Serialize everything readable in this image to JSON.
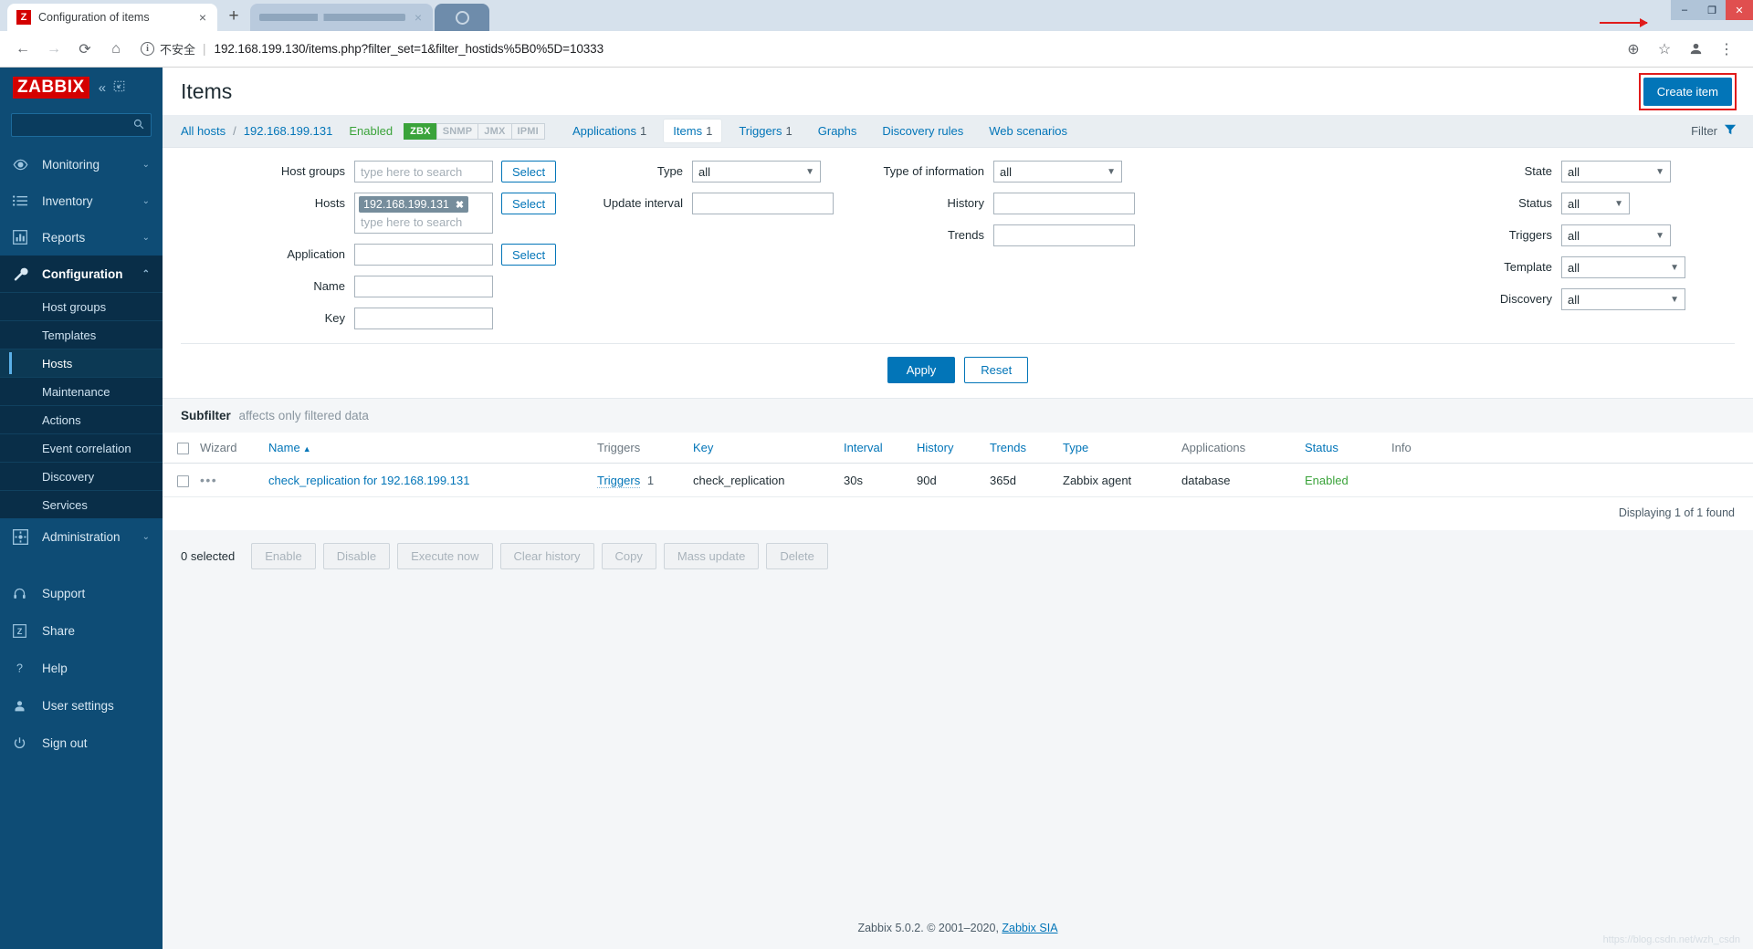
{
  "browser": {
    "active_tab_title": "Configuration of items",
    "tab_favicon": "Z",
    "close_label": "×",
    "new_tab_label": "+",
    "back_icon": "←",
    "forward_icon": "→",
    "reload_icon": "⟳",
    "home_icon": "⌂",
    "security_badge": "不安全",
    "info_icon": "i",
    "url": "192.168.199.130/items.php?filter_set=1&filter_hostids%5B0%5D=10333",
    "zoom_icon": "⊕",
    "star_icon": "☆",
    "profile_icon": "●",
    "menu_icon": "⋮",
    "minimize": "–",
    "maximize": "❐",
    "close_win": "✕"
  },
  "sidebar": {
    "logo": "ZABBIX",
    "collapse_icon": "«",
    "expand_icon": "⤡",
    "search_placeholder": "",
    "search_icon": "search-icon",
    "sections": [
      {
        "label": "Monitoring",
        "icon": "eye-icon",
        "chevron": "⌄"
      },
      {
        "label": "Inventory",
        "icon": "list-icon",
        "chevron": "⌄"
      },
      {
        "label": "Reports",
        "icon": "bar-chart-icon",
        "chevron": "⌄"
      },
      {
        "label": "Configuration",
        "icon": "wrench-icon",
        "chevron": "⌃"
      }
    ],
    "configuration_submenu": [
      "Host groups",
      "Templates",
      "Hosts",
      "Maintenance",
      "Actions",
      "Event correlation",
      "Discovery",
      "Services"
    ],
    "active_submenu": "Hosts",
    "administration": {
      "label": "Administration",
      "icon": "gear-icon",
      "chevron": "⌄"
    },
    "bottom_items": [
      {
        "label": "Support",
        "icon": "headset-icon"
      },
      {
        "label": "Share",
        "icon": "zabbix-share-icon"
      },
      {
        "label": "Help",
        "icon": "question-icon"
      },
      {
        "label": "User settings",
        "icon": "user-icon"
      },
      {
        "label": "Sign out",
        "icon": "power-icon"
      }
    ]
  },
  "header": {
    "title": "Items",
    "create_button": "Create item"
  },
  "breadcrumb": {
    "all_hosts": "All hosts",
    "separator": "/",
    "host": "192.168.199.131",
    "status": "Enabled",
    "interfaces": [
      {
        "label": "ZBX",
        "active": true
      },
      {
        "label": "SNMP",
        "active": false
      },
      {
        "label": "JMX",
        "active": false
      },
      {
        "label": "IPMI",
        "active": false
      }
    ],
    "tabs": [
      {
        "label": "Applications",
        "count": "1",
        "selected": false
      },
      {
        "label": "Items",
        "count": "1",
        "selected": true
      },
      {
        "label": "Triggers",
        "count": "1",
        "selected": false
      },
      {
        "label": "Graphs",
        "count": "",
        "selected": false
      },
      {
        "label": "Discovery rules",
        "count": "",
        "selected": false
      },
      {
        "label": "Web scenarios",
        "count": "",
        "selected": false
      }
    ],
    "filter_label": "Filter",
    "filter_icon": "funnel-icon"
  },
  "filter": {
    "host_groups": {
      "label": "Host groups",
      "placeholder": "type here to search",
      "value": "",
      "select": "Select"
    },
    "hosts": {
      "label": "Hosts",
      "chip": "192.168.199.131",
      "chip_remove": "✖",
      "placeholder": "type here to search",
      "select": "Select"
    },
    "application": {
      "label": "Application",
      "value": "",
      "select": "Select"
    },
    "name": {
      "label": "Name",
      "value": ""
    },
    "key": {
      "label": "Key",
      "value": ""
    },
    "type": {
      "label": "Type",
      "value": "all"
    },
    "update_interval": {
      "label": "Update interval",
      "value": ""
    },
    "type_of_information": {
      "label": "Type of information",
      "value": "all"
    },
    "history": {
      "label": "History",
      "value": ""
    },
    "trends": {
      "label": "Trends",
      "value": ""
    },
    "state": {
      "label": "State",
      "value": "all"
    },
    "status": {
      "label": "Status",
      "value": "all"
    },
    "triggers": {
      "label": "Triggers",
      "value": "all"
    },
    "template": {
      "label": "Template",
      "value": "all"
    },
    "discovery": {
      "label": "Discovery",
      "value": "all"
    },
    "apply": "Apply",
    "reset": "Reset",
    "chevron": "⌄"
  },
  "subfilter": {
    "title": "Subfilter",
    "hint": "affects only filtered data"
  },
  "table": {
    "columns": [
      "Wizard",
      "Name",
      "Triggers",
      "Key",
      "Interval",
      "History",
      "Trends",
      "Type",
      "Applications",
      "Status",
      "Info"
    ],
    "sort_column": "Name",
    "sort_caret": "▲",
    "rows": [
      {
        "wizard": "•••",
        "name": "check_replication for 192.168.199.131",
        "triggers_label": "Triggers",
        "triggers_count": "1",
        "key": "check_replication",
        "interval": "30s",
        "history": "90d",
        "trends": "365d",
        "type": "Zabbix agent",
        "applications": "database",
        "status": "Enabled",
        "info": ""
      }
    ],
    "found_text": "Displaying 1 of 1 found"
  },
  "actions": {
    "selected_text": "0 selected",
    "buttons": [
      "Enable",
      "Disable",
      "Execute now",
      "Clear history",
      "Copy",
      "Mass update",
      "Delete"
    ]
  },
  "footer": {
    "text": "Zabbix 5.0.2. © 2001–2020, ",
    "link": "Zabbix SIA",
    "watermark": "https://blog.csdn.net/wzh_csdn"
  }
}
